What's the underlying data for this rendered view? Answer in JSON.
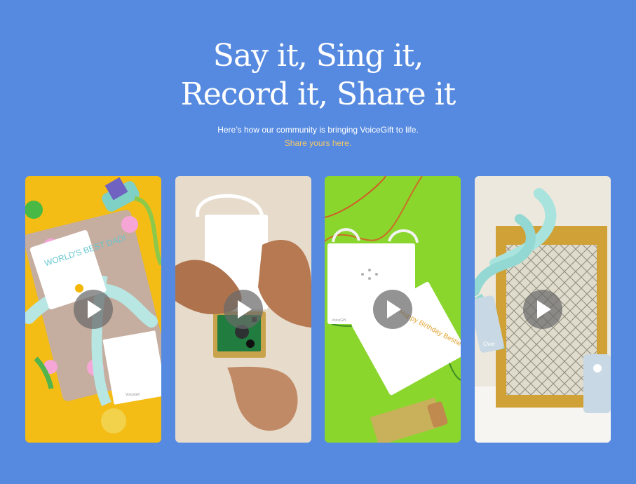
{
  "header": {
    "title_line1": "Say it, Sing it,",
    "title_line2": "Record it, Share it",
    "subtitle": "Here’s how our community is bringing VoiceGift to life.",
    "share_link": "Share yours here."
  },
  "cards": [
    {
      "artwork_text": "WORLD'S BEST DAD!",
      "tag_text": "VoiceGift"
    },
    {
      "artwork_text": ""
    },
    {
      "artwork_text": "Happy Birthday Bestie",
      "tag_text": "VoiceGift"
    },
    {
      "artwork_text": "Over"
    }
  ],
  "colors": {
    "background": "#568ae0",
    "heading": "#ffffff",
    "link": "#f2c76b",
    "play_button": "#696969"
  },
  "icons": {
    "play": "play-icon"
  }
}
